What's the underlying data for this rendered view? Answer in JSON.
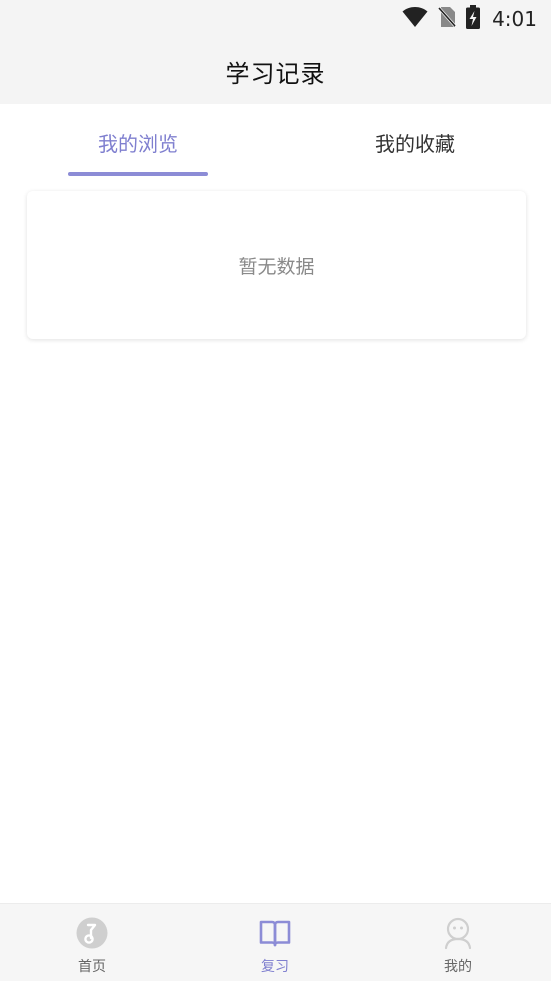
{
  "status_bar": {
    "time": "4:01",
    "icons": [
      "wifi-icon",
      "no-sim-icon",
      "battery-charging-icon"
    ]
  },
  "header": {
    "title": "学习记录"
  },
  "tabs": [
    {
      "label": "我的浏览",
      "active": true
    },
    {
      "label": "我的收藏",
      "active": false
    }
  ],
  "content": {
    "empty_text": "暂无数据"
  },
  "bottom_nav": {
    "items": [
      {
        "label": "首页",
        "icon": "home-music-note-icon",
        "active": false
      },
      {
        "label": "复习",
        "icon": "open-book-icon",
        "active": true
      },
      {
        "label": "我的",
        "icon": "profile-person-icon",
        "active": false
      }
    ]
  },
  "colors": {
    "accent": "#8c8cd6",
    "accent_text": "#7f7fcf",
    "header_bg": "#f4f4f4",
    "inactive_icon": "#cfcfcf"
  }
}
